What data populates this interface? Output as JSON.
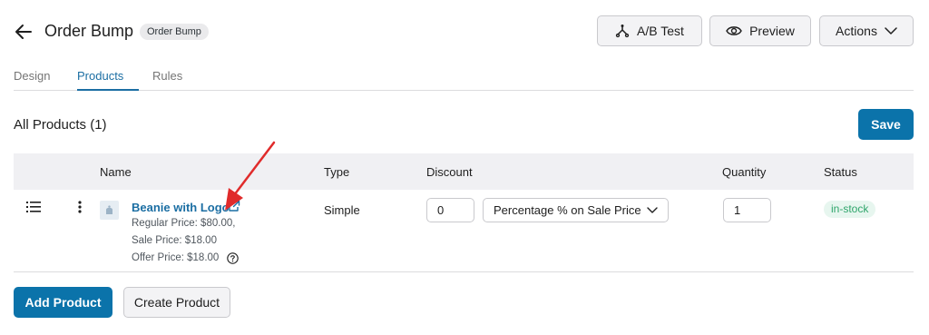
{
  "header": {
    "title": "Order Bump",
    "badge": "Order Bump",
    "buttons": {
      "ab_test": "A/B Test",
      "preview": "Preview",
      "actions": "Actions"
    }
  },
  "tabs": [
    {
      "label": "Design",
      "active": false
    },
    {
      "label": "Products",
      "active": true
    },
    {
      "label": "Rules",
      "active": false
    }
  ],
  "section": {
    "title": "All Products (1)",
    "save_label": "Save"
  },
  "table": {
    "columns": [
      "Name",
      "Type",
      "Discount",
      "Quantity",
      "Status"
    ],
    "rows": [
      {
        "name": "Beanie with Logo",
        "regular_price": "Regular Price: $80.00,",
        "sale_price": "Sale Price: $18.00",
        "offer_price": "Offer Price: $18.00",
        "type": "Simple",
        "discount_value": "0",
        "discount_type": "Percentage % on Sale Price",
        "quantity": "1",
        "status": "in-stock"
      }
    ]
  },
  "footer": {
    "add_product": "Add Product",
    "create_product": "Create Product"
  },
  "colors": {
    "primary": "#0b73aa",
    "link": "#1b6ea3",
    "status_green": "#2fa56b",
    "annotation_arrow": "#e02b2b"
  },
  "icons": {
    "back": "arrow-left-icon",
    "ab_test": "split-icon",
    "preview": "eye-icon",
    "actions": "chevron-down-icon",
    "drag": "drag-handle-icon",
    "menu": "kebab-icon",
    "external": "external-link-icon",
    "help": "help-icon"
  }
}
